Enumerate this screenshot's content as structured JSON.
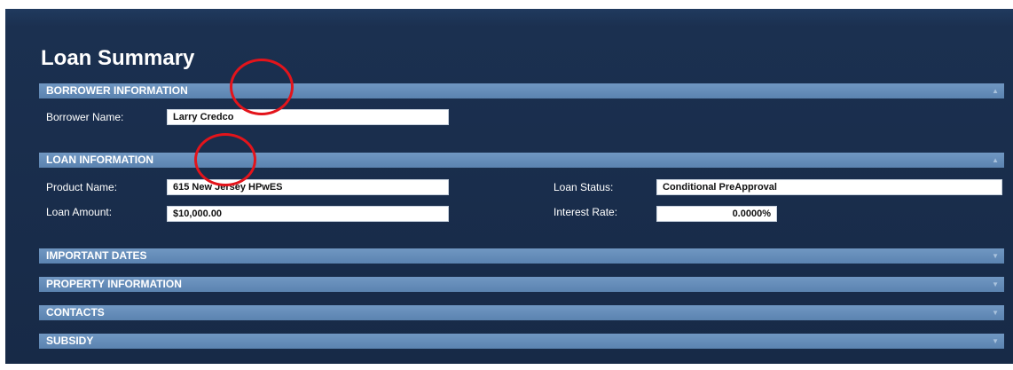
{
  "page": {
    "title": "Loan Summary"
  },
  "sections": {
    "borrower": {
      "label": "BORROWER INFORMATION",
      "toggle_icon": "collapse-arrow-icon",
      "fields": {
        "borrower_name_label": "Borrower Name:",
        "borrower_name_value": "Larry Credco"
      }
    },
    "loan": {
      "label": "LOAN INFORMATION",
      "toggle_icon": "collapse-arrow-icon",
      "fields": {
        "product_name_label": "Product Name:",
        "product_name_value": "615 New Jersey HPwES",
        "loan_amount_label": "Loan Amount:",
        "loan_amount_value": "$10,000.00",
        "loan_status_label": "Loan Status:",
        "loan_status_value": "Conditional PreApproval",
        "interest_rate_label": "Interest Rate:",
        "interest_rate_value": "0.0000%"
      }
    },
    "important_dates": {
      "label": "IMPORTANT DATES",
      "toggle_icon": "expand-arrow-icon"
    },
    "property": {
      "label": "PROPERTY INFORMATION",
      "toggle_icon": "expand-arrow-icon"
    },
    "contacts": {
      "label": "CONTACTS",
      "toggle_icon": "expand-arrow-icon"
    },
    "subsidy": {
      "label": "SUBSIDY",
      "toggle_icon": "expand-arrow-icon"
    }
  },
  "annotations": {
    "highlight_color": "#e3141b"
  },
  "colors": {
    "panel_background": "#1b3050",
    "section_bar": "#6088b4"
  }
}
